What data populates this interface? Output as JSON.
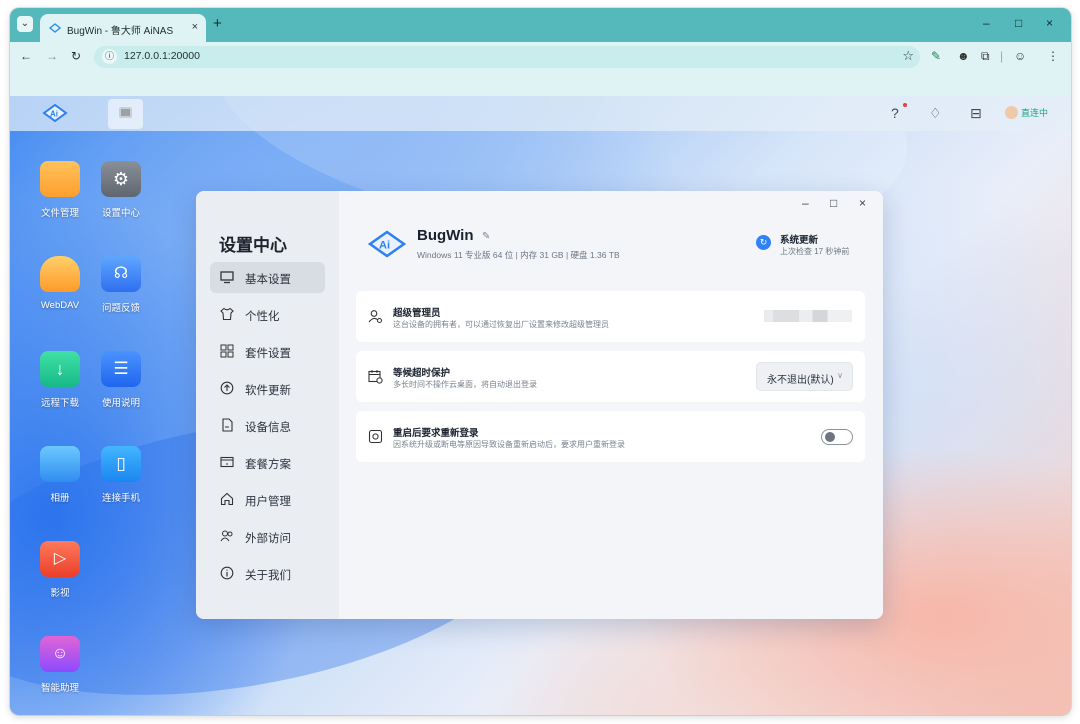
{
  "browser": {
    "tab_title": "BugWin - 鲁大师 AiNAS",
    "tab_close": "×",
    "new_tab": "+",
    "win_min": "–",
    "win_max": "□",
    "win_close": "×",
    "url": "127.0.0.1:20000",
    "accent": "#55b9bc"
  },
  "taskbar": {
    "user_status": "直连中",
    "status_color": "#18a58a"
  },
  "desktop": {
    "icons": [
      {
        "label": "文件管理"
      },
      {
        "label": "设置中心"
      },
      {
        "label": "WebDAV"
      },
      {
        "label": "问题反馈"
      },
      {
        "label": "远程下载"
      },
      {
        "label": "使用说明"
      },
      {
        "label": "相册"
      },
      {
        "label": "连接手机"
      },
      {
        "label": "影视"
      },
      {
        "label": "智能助理"
      }
    ]
  },
  "settings": {
    "title": "设置中心",
    "nav": [
      {
        "label": "基本设置",
        "active": true
      },
      {
        "label": "个性化"
      },
      {
        "label": "套件设置"
      },
      {
        "label": "软件更新"
      },
      {
        "label": "设备信息"
      },
      {
        "label": "套餐方案"
      },
      {
        "label": "用户管理"
      },
      {
        "label": "外部访问"
      },
      {
        "label": "关于我们"
      }
    ],
    "window_controls": {
      "min": "–",
      "max": "□",
      "close": "×"
    },
    "device": {
      "name": "BugWin",
      "specs": "Windows 11 专业版 64 位 | 内存 31 GB | 硬盘 1.36 TB"
    },
    "update": {
      "title": "系统更新",
      "subtitle": "上次检查 17 秒钟前"
    },
    "cards": [
      {
        "title": "超级管理员",
        "desc": "这台设备的拥有者，可以通过恢复出厂设置来修改超级管理员"
      },
      {
        "title": "等候超时保护",
        "desc": "多长时间不操作云桌面，将自动退出登录",
        "select_value": "永不退出(默认)"
      },
      {
        "title": "重启后要求重新登录",
        "desc": "因系统升级或断电等原因导致设备重新启动后，要求用户重新登录",
        "toggle": false
      }
    ]
  }
}
